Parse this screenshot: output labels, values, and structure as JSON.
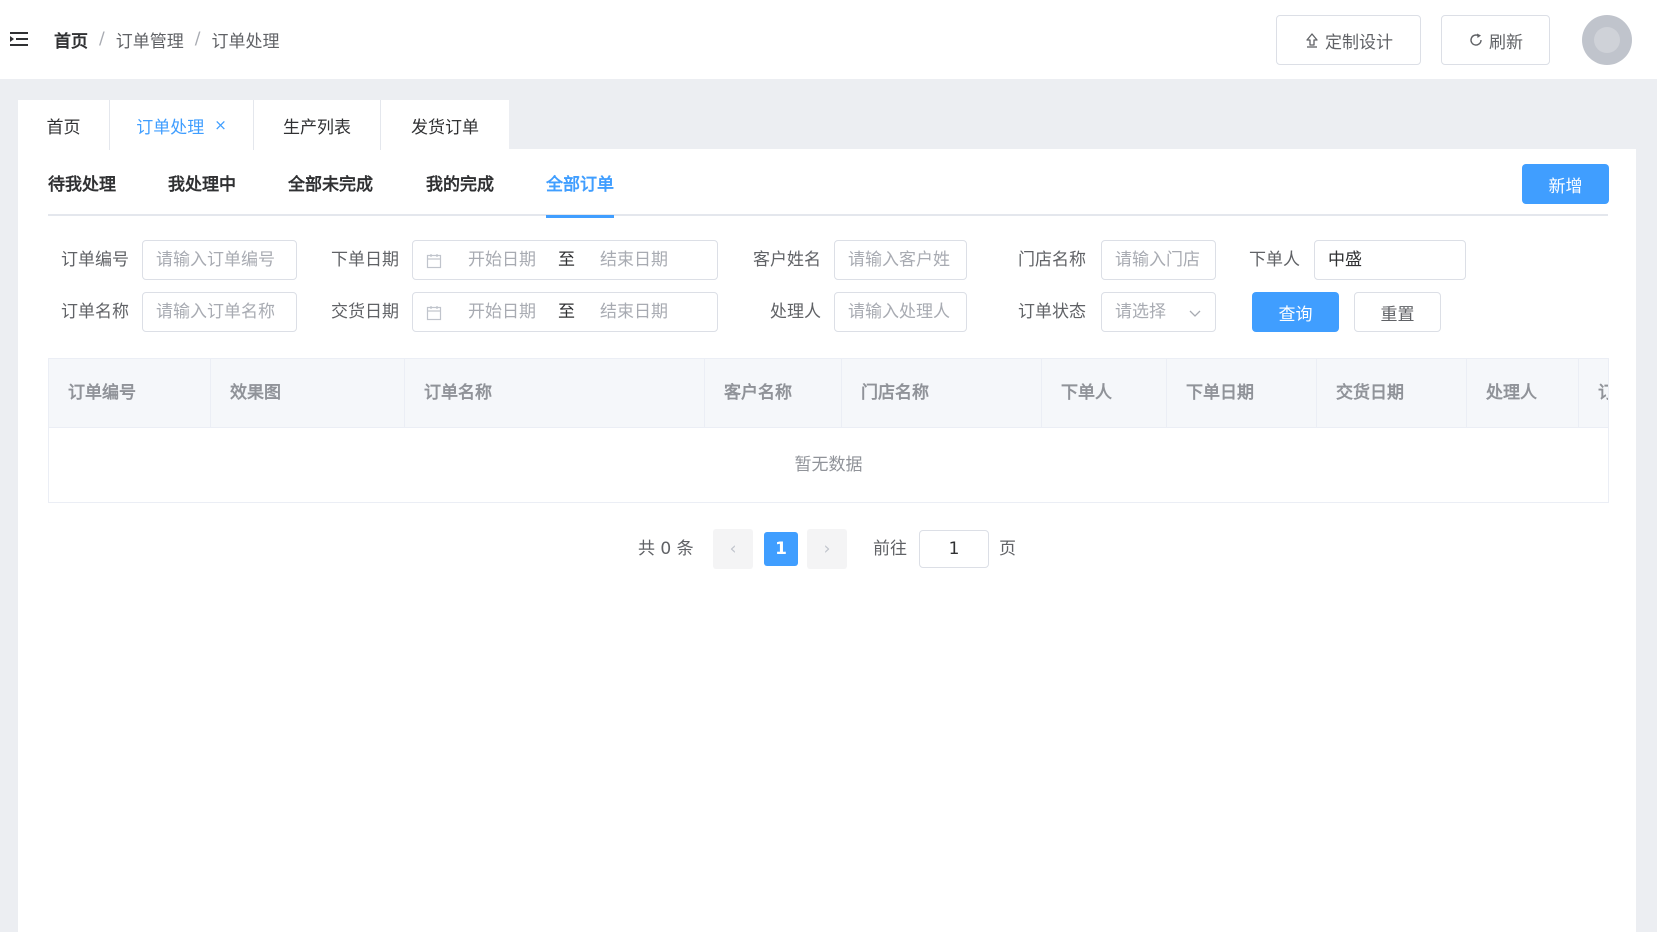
{
  "breadcrumb": [
    "首页",
    "订单管理",
    "订单处理"
  ],
  "breadcrumb_separator": "/",
  "header": {
    "design_button": "定制设计",
    "refresh_button": "刷新"
  },
  "view_tabs": [
    {
      "label": "首页"
    },
    {
      "label": "订单处理",
      "close": "×"
    },
    {
      "label": "生产列表"
    },
    {
      "label": "发货订单"
    }
  ],
  "status_tabs": [
    "待我处理",
    "我处理中",
    "全部未完成",
    "我的完成",
    "全部订单"
  ],
  "add_button": "新增",
  "filters": {
    "order_no": {
      "label": "订单编号",
      "placeholder": "请输入订单编号"
    },
    "order_date": {
      "label": "下单日期",
      "start": "开始日期",
      "separator": "至",
      "end": "结束日期"
    },
    "customer": {
      "label": "客户姓名",
      "placeholder": "请输入客户姓"
    },
    "store": {
      "label": "门店名称",
      "placeholder": "请输入门店"
    },
    "orderer": {
      "label": "下单人",
      "value": "中盛"
    },
    "order_name": {
      "label": "订单名称",
      "placeholder": "请输入订单名称"
    },
    "delivery_date": {
      "label": "交货日期",
      "start": "开始日期",
      "separator": "至",
      "end": "结束日期"
    },
    "handler": {
      "label": "处理人",
      "placeholder": "请输入处理人"
    },
    "status": {
      "label": "订单状态",
      "placeholder": "请选择"
    },
    "query_button": "查询",
    "reset_button": "重置"
  },
  "table": {
    "columns": [
      "订单编号",
      "效果图",
      "订单名称",
      "客户名称",
      "门店名称",
      "下单人",
      "下单日期",
      "交货日期",
      "处理人",
      "订"
    ],
    "empty_text": "暂无数据"
  },
  "pagination": {
    "total": "共 0 条",
    "prev": "‹",
    "current": "1",
    "next": "›",
    "goto_label": "前往",
    "goto_value": "1",
    "page_suffix": "页"
  },
  "colors": {
    "primary": "#409eff",
    "border": "#dcdfe6",
    "background": "#eceef2"
  }
}
